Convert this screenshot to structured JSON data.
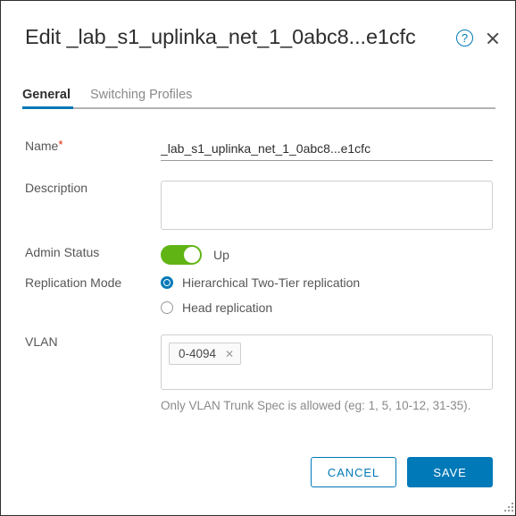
{
  "dialog": {
    "title": "Edit _lab_s1_uplinka_net_1_0abc8...e1cfc",
    "help_icon": "help-circle-icon",
    "close_icon": "close-icon"
  },
  "tabs": [
    {
      "label": "General",
      "active": true
    },
    {
      "label": "Switching Profiles",
      "active": false
    }
  ],
  "form": {
    "name": {
      "label": "Name",
      "required_marker": "*",
      "value": "_lab_s1_uplinka_net_1_0abc8...e1cfc",
      "placeholder": ""
    },
    "description": {
      "label": "Description",
      "value": "",
      "placeholder": ""
    },
    "admin_status": {
      "label": "Admin Status",
      "state_label": "Up",
      "enabled": true
    },
    "replication_mode": {
      "label": "Replication Mode",
      "options": [
        {
          "label": "Hierarchical Two-Tier replication",
          "selected": true
        },
        {
          "label": "Head replication",
          "selected": false
        }
      ]
    },
    "vlan": {
      "label": "VLAN",
      "tags": [
        {
          "value": "0-4094",
          "remove_icon": "close-icon"
        }
      ],
      "help_text": "Only VLAN Trunk Spec is allowed (eg: 1, 5, 10-12, 31-35)."
    }
  },
  "footer": {
    "cancel_label": "CANCEL",
    "save_label": "SAVE"
  },
  "colors": {
    "accent_blue": "#0079b8",
    "toggle_green": "#60b515",
    "required_red": "#e02200",
    "text_dark": "#2e2e2e",
    "text_muted": "#565656",
    "text_light": "#8a8a8a"
  }
}
